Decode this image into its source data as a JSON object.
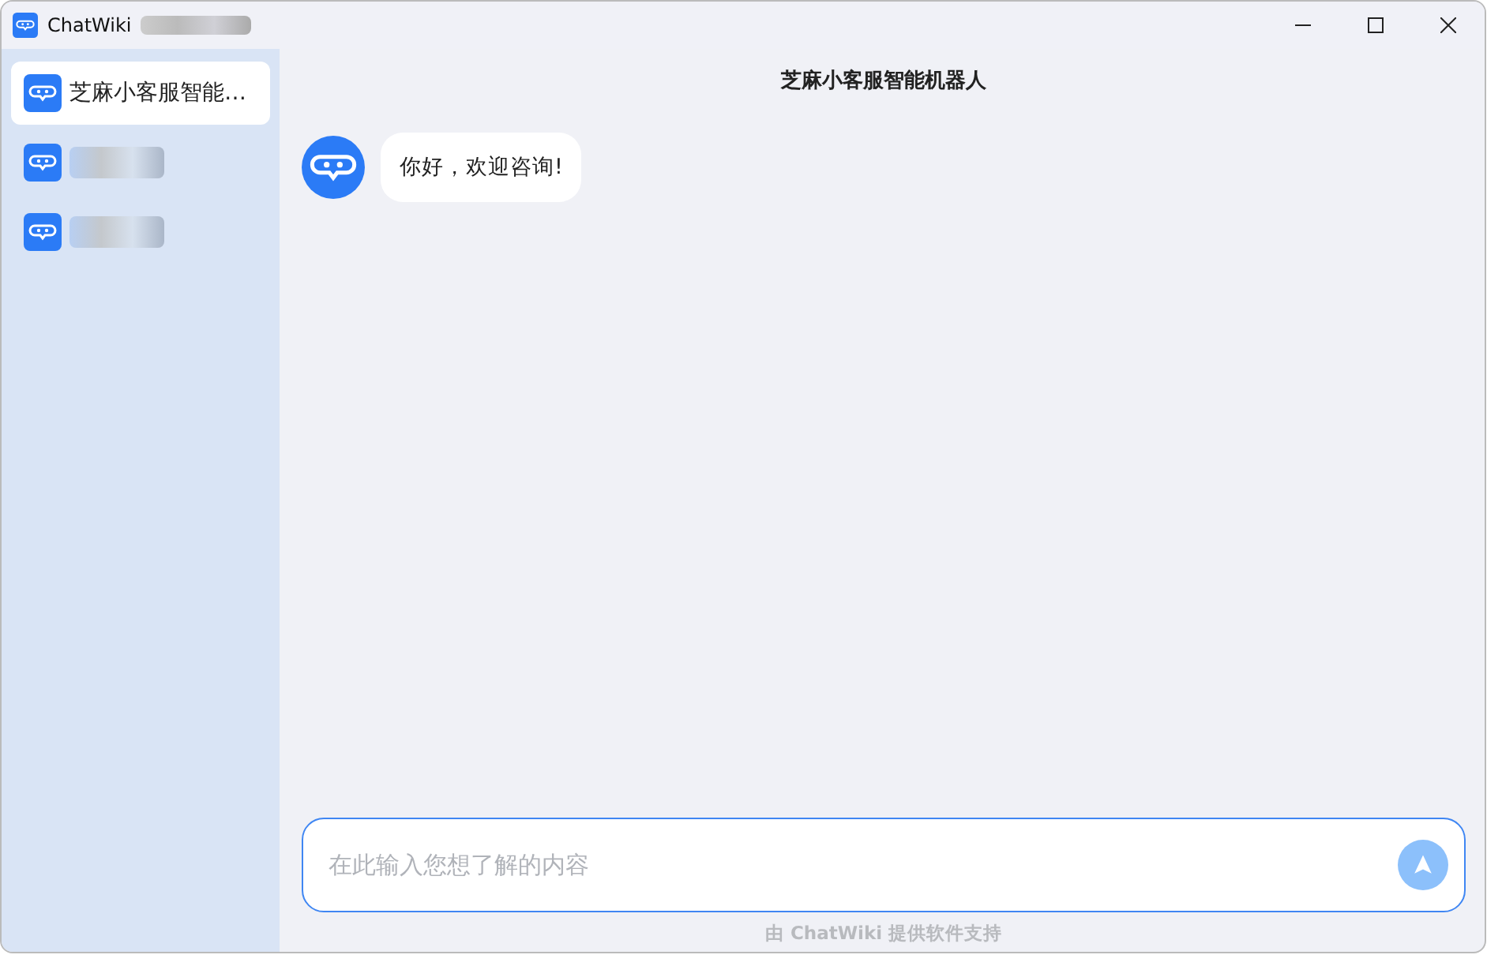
{
  "window": {
    "title": "ChatWiki",
    "title_redacted": true
  },
  "sidebar": {
    "items": [
      {
        "kind": "named",
        "label": "芝麻小客服智能…",
        "selected": true
      },
      {
        "kind": "redacted",
        "selected": false
      },
      {
        "kind": "redacted",
        "selected": false
      }
    ]
  },
  "chat": {
    "title": "芝麻小客服智能机器人",
    "messages": [
      {
        "text": "你好，欢迎咨询!"
      }
    ]
  },
  "composer": {
    "placeholder": "在此输入您想了解的内容"
  },
  "footer": "由 ChatWiki 提供软件支持"
}
